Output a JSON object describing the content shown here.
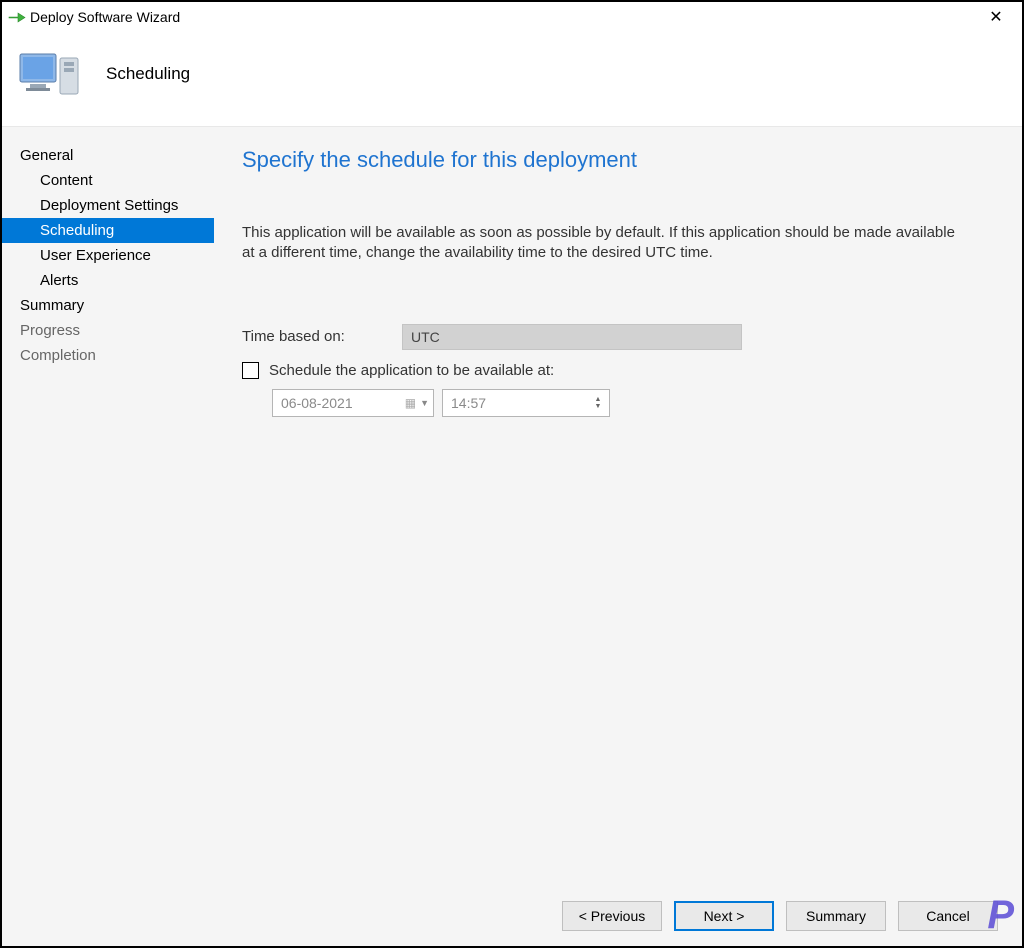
{
  "window": {
    "title": "Deploy Software Wizard"
  },
  "header": {
    "title": "Scheduling"
  },
  "sidebar": {
    "items": [
      {
        "label": "General",
        "indent": false,
        "active": false,
        "dim": false
      },
      {
        "label": "Content",
        "indent": true,
        "active": false,
        "dim": false
      },
      {
        "label": "Deployment Settings",
        "indent": true,
        "active": false,
        "dim": false
      },
      {
        "label": "Scheduling",
        "indent": true,
        "active": true,
        "dim": false
      },
      {
        "label": "User Experience",
        "indent": true,
        "active": false,
        "dim": false
      },
      {
        "label": "Alerts",
        "indent": true,
        "active": false,
        "dim": false
      },
      {
        "label": "Summary",
        "indent": false,
        "active": false,
        "dim": false
      },
      {
        "label": "Progress",
        "indent": false,
        "active": false,
        "dim": true
      },
      {
        "label": "Completion",
        "indent": false,
        "active": false,
        "dim": true
      }
    ]
  },
  "content": {
    "heading": "Specify the schedule for this deployment",
    "description": "This application will be available as soon as possible by default. If this application should be made available at a different time, change the availability time to the desired UTC time.",
    "time_based_on_label": "Time based on:",
    "time_based_on_value": "UTC",
    "schedule_checkbox_label": "Schedule the application to be available at:",
    "schedule_checkbox_checked": false,
    "date_value": "06-08-2021",
    "time_value": "14:57"
  },
  "footer": {
    "previous": "< Previous",
    "next": "Next >",
    "summary": "Summary",
    "cancel": "Cancel"
  },
  "watermark": "P"
}
